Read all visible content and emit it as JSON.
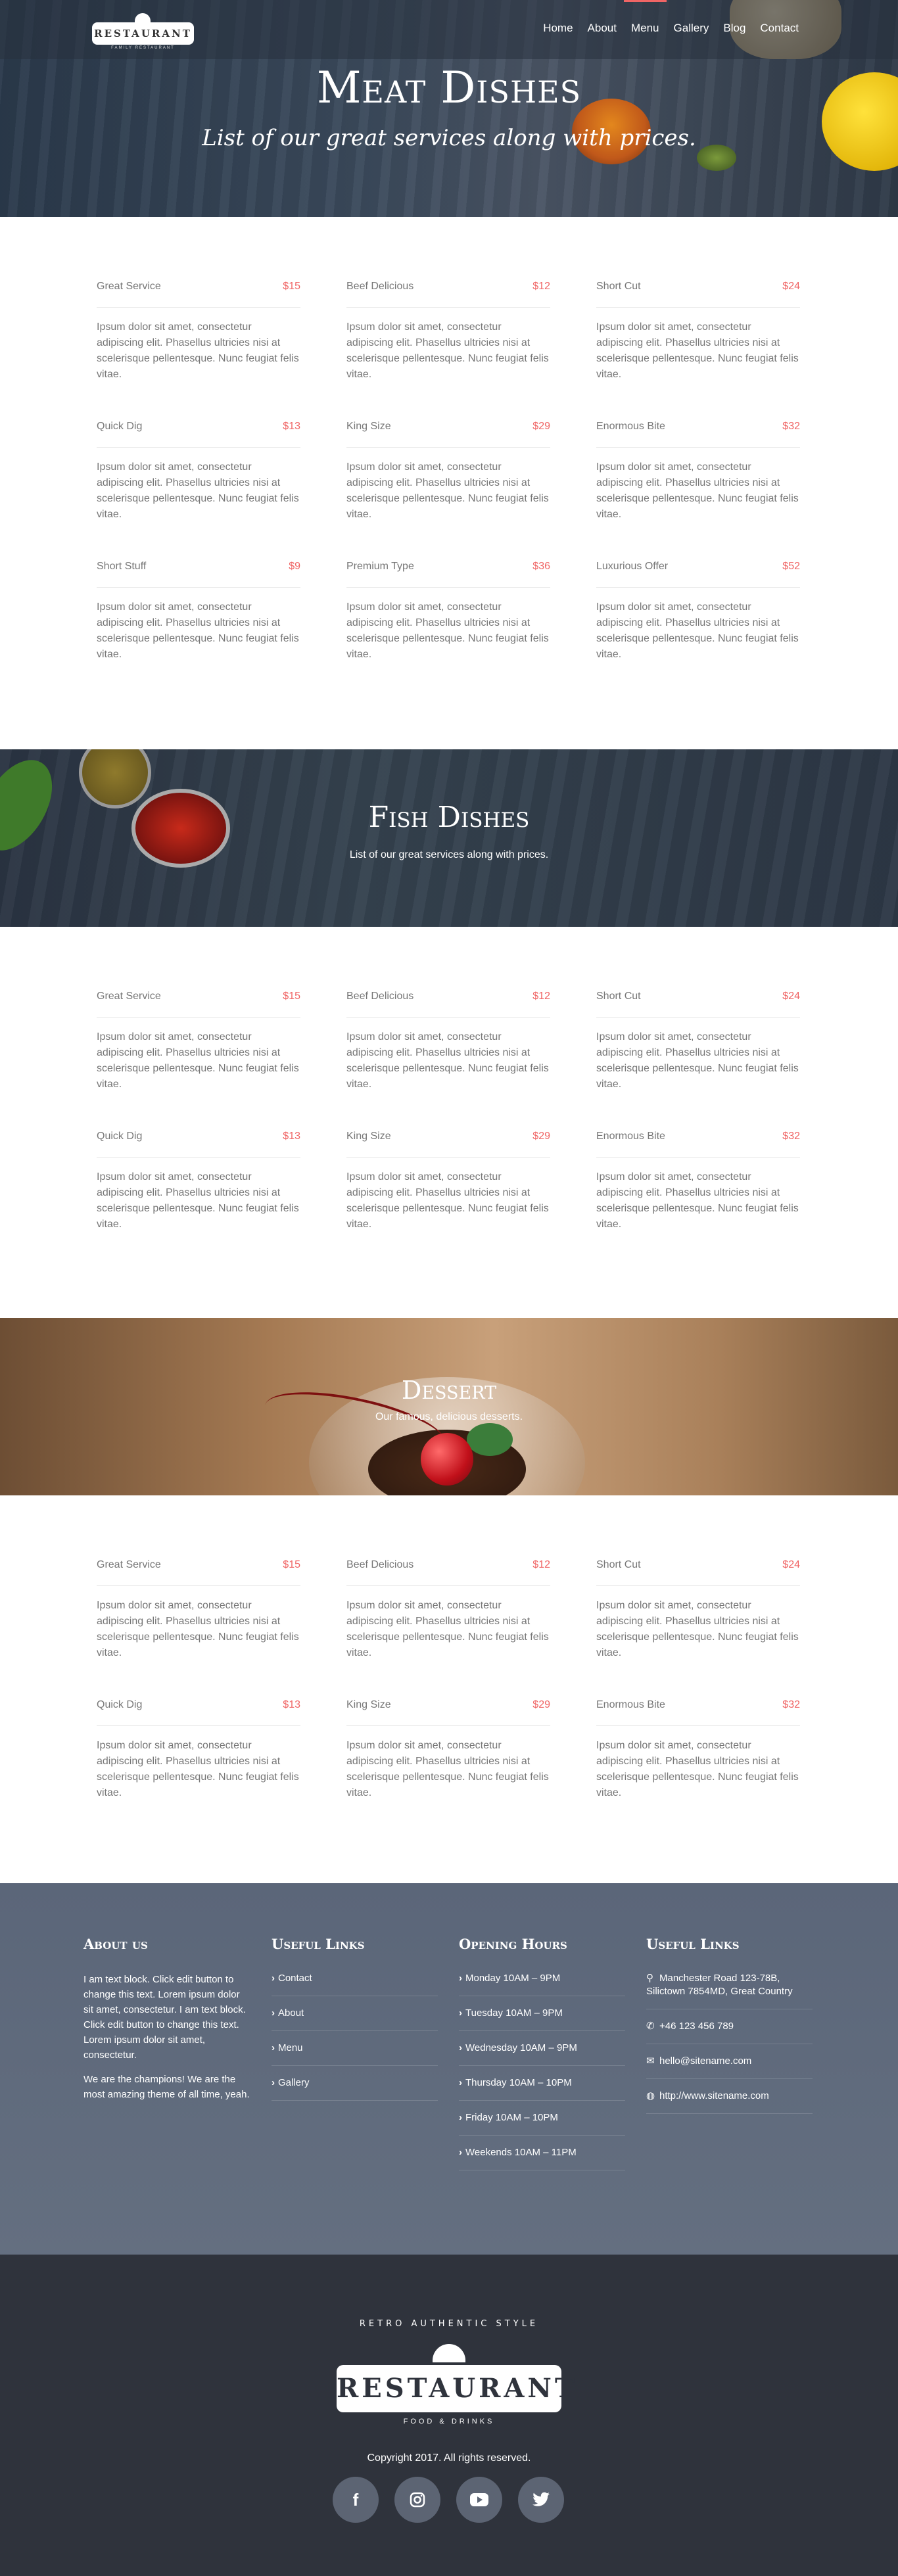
{
  "header": {
    "logo_text": "RESTAURANT",
    "logo_sub": "FAMILY RESTAURANT",
    "nav": [
      "Home",
      "About",
      "Menu",
      "Gallery",
      "Blog",
      "Contact"
    ],
    "active_nav": "Menu",
    "accent_color": "#f06565"
  },
  "hero": {
    "title": "Meat Dishes",
    "subtitle": "List of our great services along with prices."
  },
  "desc": "Ipsum dolor sit amet, consectetur adipiscing elit. Phasellus ultricies nisi at scelerisque pellentesque. Nunc feugiat felis vitae.",
  "meat_items": [
    {
      "name": "Great Service",
      "price": "$15"
    },
    {
      "name": "Beef Delicious",
      "price": "$12"
    },
    {
      "name": "Short Cut",
      "price": "$24"
    },
    {
      "name": "Quick Dig",
      "price": "$13"
    },
    {
      "name": "King Size",
      "price": "$29"
    },
    {
      "name": "Enormous Bite",
      "price": "$32"
    },
    {
      "name": "Short Stuff",
      "price": "$9"
    },
    {
      "name": "Premium Type",
      "price": "$36"
    },
    {
      "name": "Luxurious Offer",
      "price": "$52"
    }
  ],
  "fish": {
    "title": "Fish Dishes",
    "subtitle": "List of our great services along with prices."
  },
  "fish_items": [
    {
      "name": "Great Service",
      "price": "$15"
    },
    {
      "name": "Beef Delicious",
      "price": "$12"
    },
    {
      "name": "Short Cut",
      "price": "$24"
    },
    {
      "name": "Quick Dig",
      "price": "$13"
    },
    {
      "name": "King Size",
      "price": "$29"
    },
    {
      "name": "Enormous Bite",
      "price": "$32"
    }
  ],
  "dessert": {
    "title": "Dessert",
    "subtitle": "Our famous, delicious desserts."
  },
  "dessert_items": [
    {
      "name": "Great Service",
      "price": "$15"
    },
    {
      "name": "Beef Delicious",
      "price": "$12"
    },
    {
      "name": "Short Cut",
      "price": "$24"
    },
    {
      "name": "Quick Dig",
      "price": "$13"
    },
    {
      "name": "King Size",
      "price": "$29"
    },
    {
      "name": "Enormous Bite",
      "price": "$32"
    }
  ],
  "footer": {
    "about_title": "About us",
    "about_p1": "I am text block. Click edit button to change this text. Lorem ipsum dolor sit amet, consectetur. I am text block. Click edit button to change this text. Lorem ipsum dolor sit amet, consectetur.",
    "about_p2": "We are the champions! We are the most amazing theme of all time, yeah.",
    "links_title": "Useful Links",
    "links": [
      "Contact",
      "About",
      "Menu",
      "Gallery"
    ],
    "hours_title": "Opening Hours",
    "hours": [
      "Monday 10AM – 9PM",
      "Tuesday 10AM – 9PM",
      "Wednesday 10AM – 9PM",
      "Thursday 10AM – 10PM",
      "Friday 10AM – 10PM",
      "Weekends 10AM – 11PM"
    ],
    "contact_title": "Useful Links",
    "contact": {
      "address": "Manchester Road 123-78B, Silictown 7854MD, Great Country",
      "phone": "+46 123 456 789",
      "email": "hello@sitename.com",
      "web": "http://www.sitename.com"
    }
  },
  "bottom": {
    "emblem_arc": "RETRO AUTHENTIC STYLE",
    "emblem_text": "RESTAURANT",
    "emblem_sub": "FOOD & DRINKS",
    "copyright": "Copyright 2017. All rights reserved.",
    "socials": [
      "facebook-icon",
      "instagram-icon",
      "youtube-icon",
      "twitter-icon"
    ]
  }
}
